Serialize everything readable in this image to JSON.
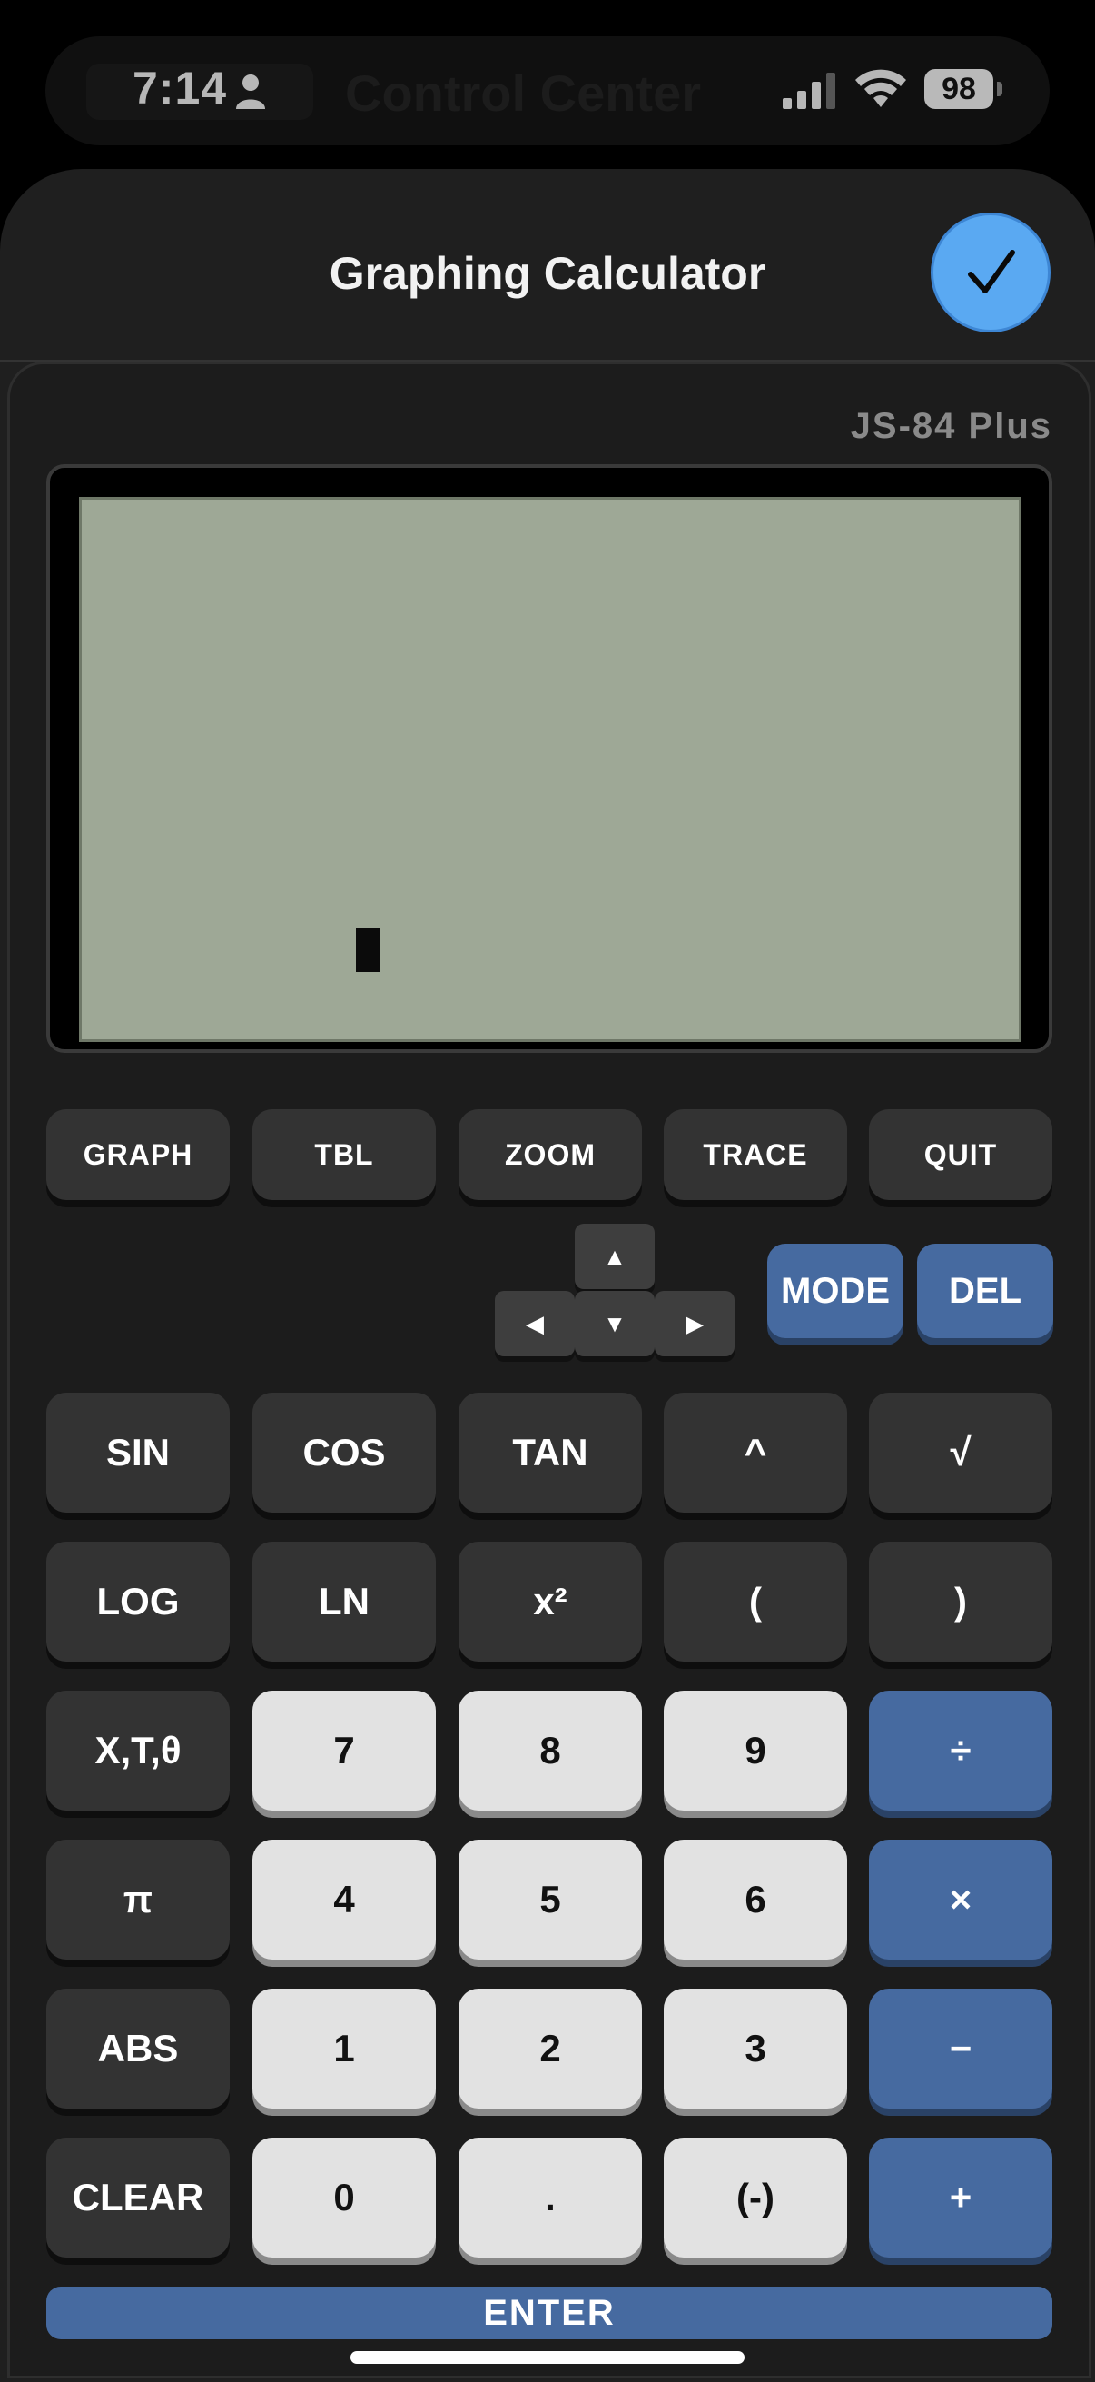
{
  "status_bar": {
    "time": "7:14",
    "ghost_text": "Control Center",
    "battery": "98"
  },
  "sheet": {
    "title": "Graphing Calculator"
  },
  "calculator": {
    "model": "JS-84 Plus",
    "function_keys": [
      "GRAPH",
      "TBL",
      "ZOOM",
      "TRACE",
      "QUIT"
    ],
    "dpad": {
      "up": "▲",
      "left": "◀",
      "down": "▼",
      "right": "▶"
    },
    "mode_key": "MODE",
    "del_key": "DEL",
    "rows": [
      [
        "SIN",
        "COS",
        "TAN",
        "^",
        "√"
      ],
      [
        "LOG",
        "LN",
        "x²",
        "(",
        ")"
      ],
      [
        "X,T,θ",
        "7",
        "8",
        "9",
        "÷"
      ],
      [
        "π",
        "4",
        "5",
        "6",
        "×"
      ],
      [
        "ABS",
        "1",
        "2",
        "3",
        "−"
      ],
      [
        "CLEAR",
        "0",
        ".",
        "(-)",
        "+"
      ]
    ],
    "enter_key": "ENTER"
  },
  "colors": {
    "accent_blue": "#466aa0",
    "done_blue": "#5aa9f2",
    "lcd": "#9ea896"
  }
}
